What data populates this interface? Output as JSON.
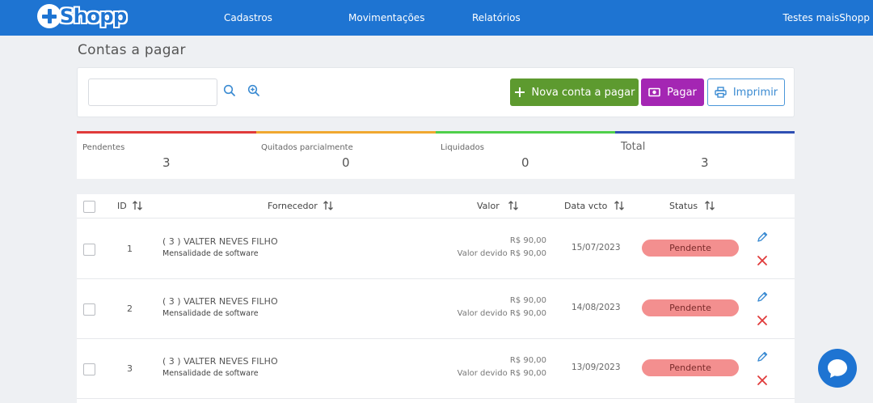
{
  "brand": {
    "name": "Shopp"
  },
  "nav": {
    "cadastros": "Cadastros",
    "movimentacoes": "Movimentações",
    "relatorios": "Relatórios",
    "user": "Testes maisShopp"
  },
  "page": {
    "title": "Contas a pagar"
  },
  "toolbar": {
    "search_value": "",
    "new_label": "Nova conta a pagar",
    "pay_label": "Pagar",
    "print_label": "Imprimir"
  },
  "summary": {
    "pendentes_label": "Pendentes",
    "pendentes_value": "3",
    "quitados_label": "Quitados parcialmente",
    "quitados_value": "0",
    "liquidados_label": "Liquidados",
    "liquidados_value": "0",
    "total_label": "Total",
    "total_value": "3",
    "colors": [
      "#e03a3a",
      "#f0a830",
      "#4fcf4a",
      "#2e4fb3"
    ]
  },
  "table": {
    "headers": {
      "id": "ID",
      "fornecedor": "Fornecedor",
      "valor": "Valor",
      "data": "Data vcto",
      "status": "Status"
    },
    "rows": [
      {
        "id": "1",
        "fornecedor": "( 3 ) VALTER NEVES FILHO",
        "descricao": "Mensalidade de software",
        "valor": "R$ 90,00",
        "valor_devido": "Valor devido R$ 90,00",
        "data": "15/07/2023",
        "status": "Pendente"
      },
      {
        "id": "2",
        "fornecedor": "( 3 ) VALTER NEVES FILHO",
        "descricao": "Mensalidade de software",
        "valor": "R$ 90,00",
        "valor_devido": "Valor devido R$ 90,00",
        "data": "14/08/2023",
        "status": "Pendente"
      },
      {
        "id": "3",
        "fornecedor": "( 3 ) VALTER NEVES FILHO",
        "descricao": "Mensalidade de software",
        "valor": "R$ 90,00",
        "valor_devido": "Valor devido R$ 90,00",
        "data": "13/09/2023",
        "status": "Pendente"
      }
    ]
  }
}
